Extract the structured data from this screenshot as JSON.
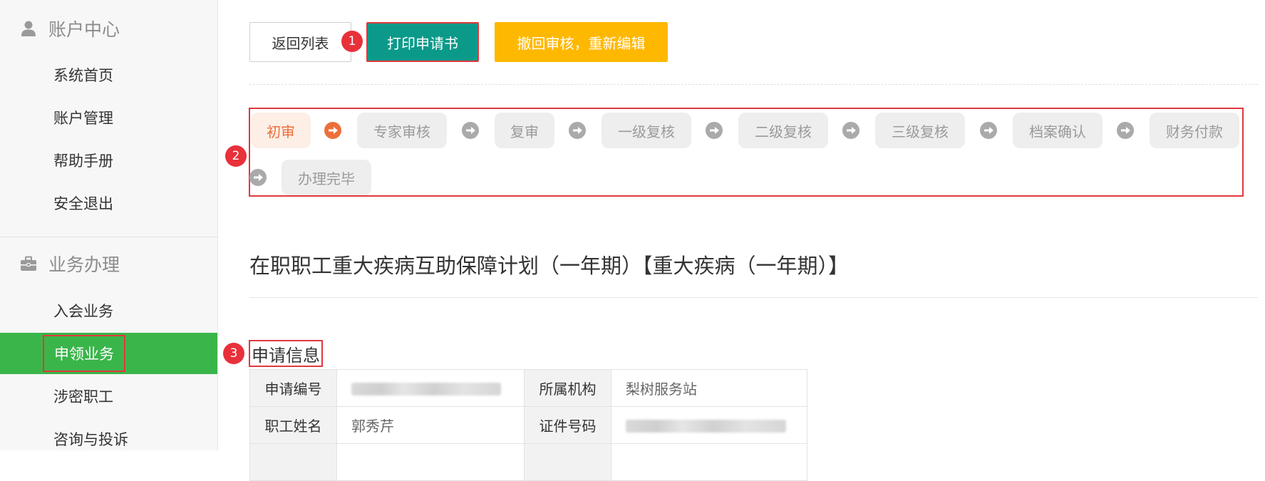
{
  "sidebar": {
    "account_section": {
      "title": "账户中心",
      "icon": "user-icon"
    },
    "account_items": [
      "系统首页",
      "账户管理",
      "帮助手册",
      "安全退出"
    ],
    "business_section": {
      "title": "业务办理",
      "icon": "briefcase-icon"
    },
    "business_items": [
      "入会业务",
      "申领业务",
      "涉密职工",
      "咨询与投诉"
    ],
    "active_item": "申领业务"
  },
  "toolbar": {
    "back_label": "返回列表",
    "print_label": "打印申请书",
    "withdraw_label": "撤回审核，重新编辑"
  },
  "markers": [
    "1",
    "2",
    "3"
  ],
  "workflow": {
    "steps": [
      "初审",
      "专家审核",
      "复审",
      "一级复核",
      "二级复核",
      "三级复核",
      "档案确认",
      "财务付款",
      "办理完毕"
    ],
    "current": "初审"
  },
  "page_title": "在职职工重大疾病互助保障计划（一年期）【重大疾病（一年期）】",
  "section_title": "申请信息",
  "info_table": {
    "rows": [
      {
        "label1": "申请编号",
        "value1": "",
        "label2": "所属机构",
        "value2": "梨树服务站"
      },
      {
        "label1": "职工姓名",
        "value1": "郭秀芹",
        "label2": "证件号码",
        "value2": ""
      }
    ]
  },
  "colors": {
    "sidebar_active": "#3ab54a",
    "print_button": "#0b9a8a",
    "withdraw_button": "#ffb800",
    "highlight_border": "#e0393e",
    "current_step_text": "#ec6f3a"
  }
}
